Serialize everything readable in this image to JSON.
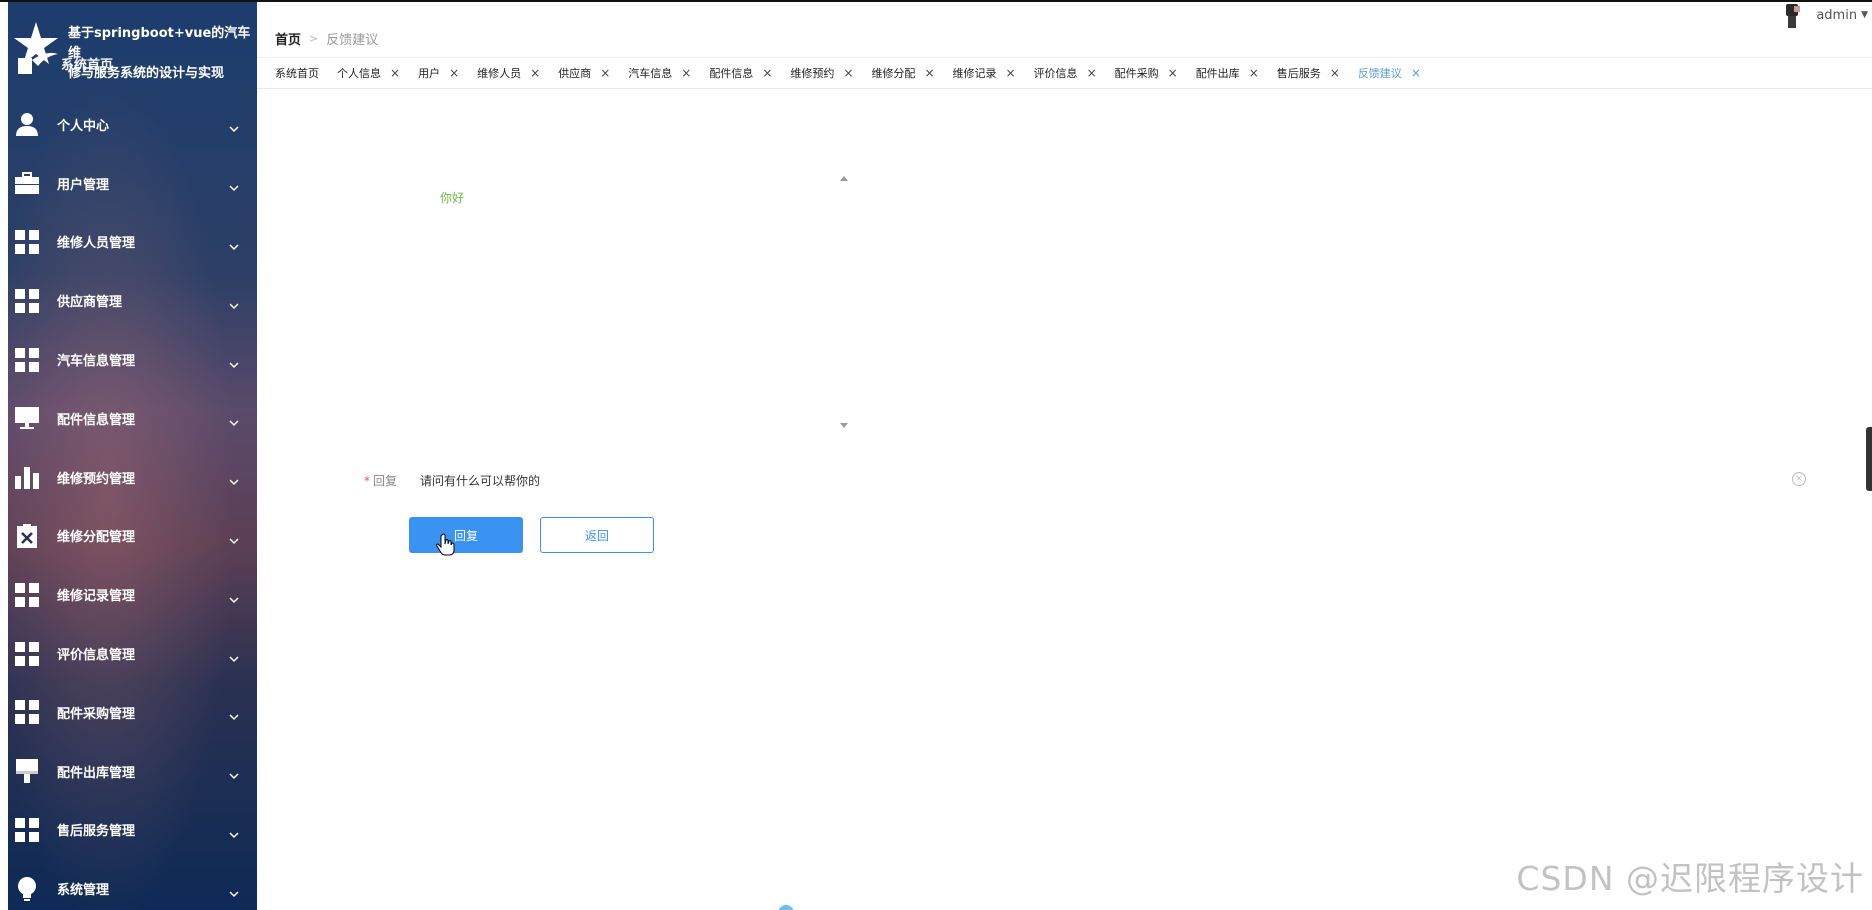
{
  "app": {
    "title_line1": "基于springboot+vue的汽车维",
    "title_line2": "修与服务系统的设计与实现",
    "overlay_text": "系统首页"
  },
  "sidebar": {
    "items": [
      {
        "label": "个人中心",
        "icon": "person-icon"
      },
      {
        "label": "用户管理",
        "icon": "briefcase-icon"
      },
      {
        "label": "维修人员管理",
        "icon": "grid-icon"
      },
      {
        "label": "供应商管理",
        "icon": "grid-icon"
      },
      {
        "label": "汽车信息管理",
        "icon": "grid-icon"
      },
      {
        "label": "配件信息管理",
        "icon": "monitor-icon"
      },
      {
        "label": "维修预约管理",
        "icon": "bar-chart-icon"
      },
      {
        "label": "维修分配管理",
        "icon": "clipboard-x-icon"
      },
      {
        "label": "维修记录管理",
        "icon": "grid-icon"
      },
      {
        "label": "评价信息管理",
        "icon": "grid-icon"
      },
      {
        "label": "配件采购管理",
        "icon": "grid-icon"
      },
      {
        "label": "配件出库管理",
        "icon": "brush-icon"
      },
      {
        "label": "售后服务管理",
        "icon": "grid-icon"
      },
      {
        "label": "系统管理",
        "icon": "bulb-icon"
      }
    ]
  },
  "header": {
    "breadcrumb_home": "首页",
    "breadcrumb_sep": ">",
    "breadcrumb_current": "反馈建议",
    "user_name": "admin"
  },
  "tabs": [
    {
      "label": "系统首页",
      "closable": false,
      "active": false
    },
    {
      "label": "个人信息",
      "closable": true,
      "active": false
    },
    {
      "label": "用户",
      "closable": true,
      "active": false
    },
    {
      "label": "维修人员",
      "closable": true,
      "active": false
    },
    {
      "label": "供应商",
      "closable": true,
      "active": false
    },
    {
      "label": "汽车信息",
      "closable": true,
      "active": false
    },
    {
      "label": "配件信息",
      "closable": true,
      "active": false
    },
    {
      "label": "维修预约",
      "closable": true,
      "active": false
    },
    {
      "label": "维修分配",
      "closable": true,
      "active": false
    },
    {
      "label": "维修记录",
      "closable": true,
      "active": false
    },
    {
      "label": "评价信息",
      "closable": true,
      "active": false
    },
    {
      "label": "配件采购",
      "closable": true,
      "active": false
    },
    {
      "label": "配件出库",
      "closable": true,
      "active": false
    },
    {
      "label": "售后服务",
      "closable": true,
      "active": false
    },
    {
      "label": "反馈建议",
      "closable": true,
      "active": true
    }
  ],
  "content": {
    "feedback_message": "你好",
    "reply_label": "回复",
    "reply_required_mark": "*",
    "reply_value": "请问有什么可以帮你的",
    "reply_button": "回复",
    "back_button": "返回"
  },
  "watermark": "CSDN @迟限程序设计",
  "colors": {
    "primary": "#3a93f2",
    "active_tab": "#5b9bd5",
    "feedback_text": "#6fbf4a"
  }
}
